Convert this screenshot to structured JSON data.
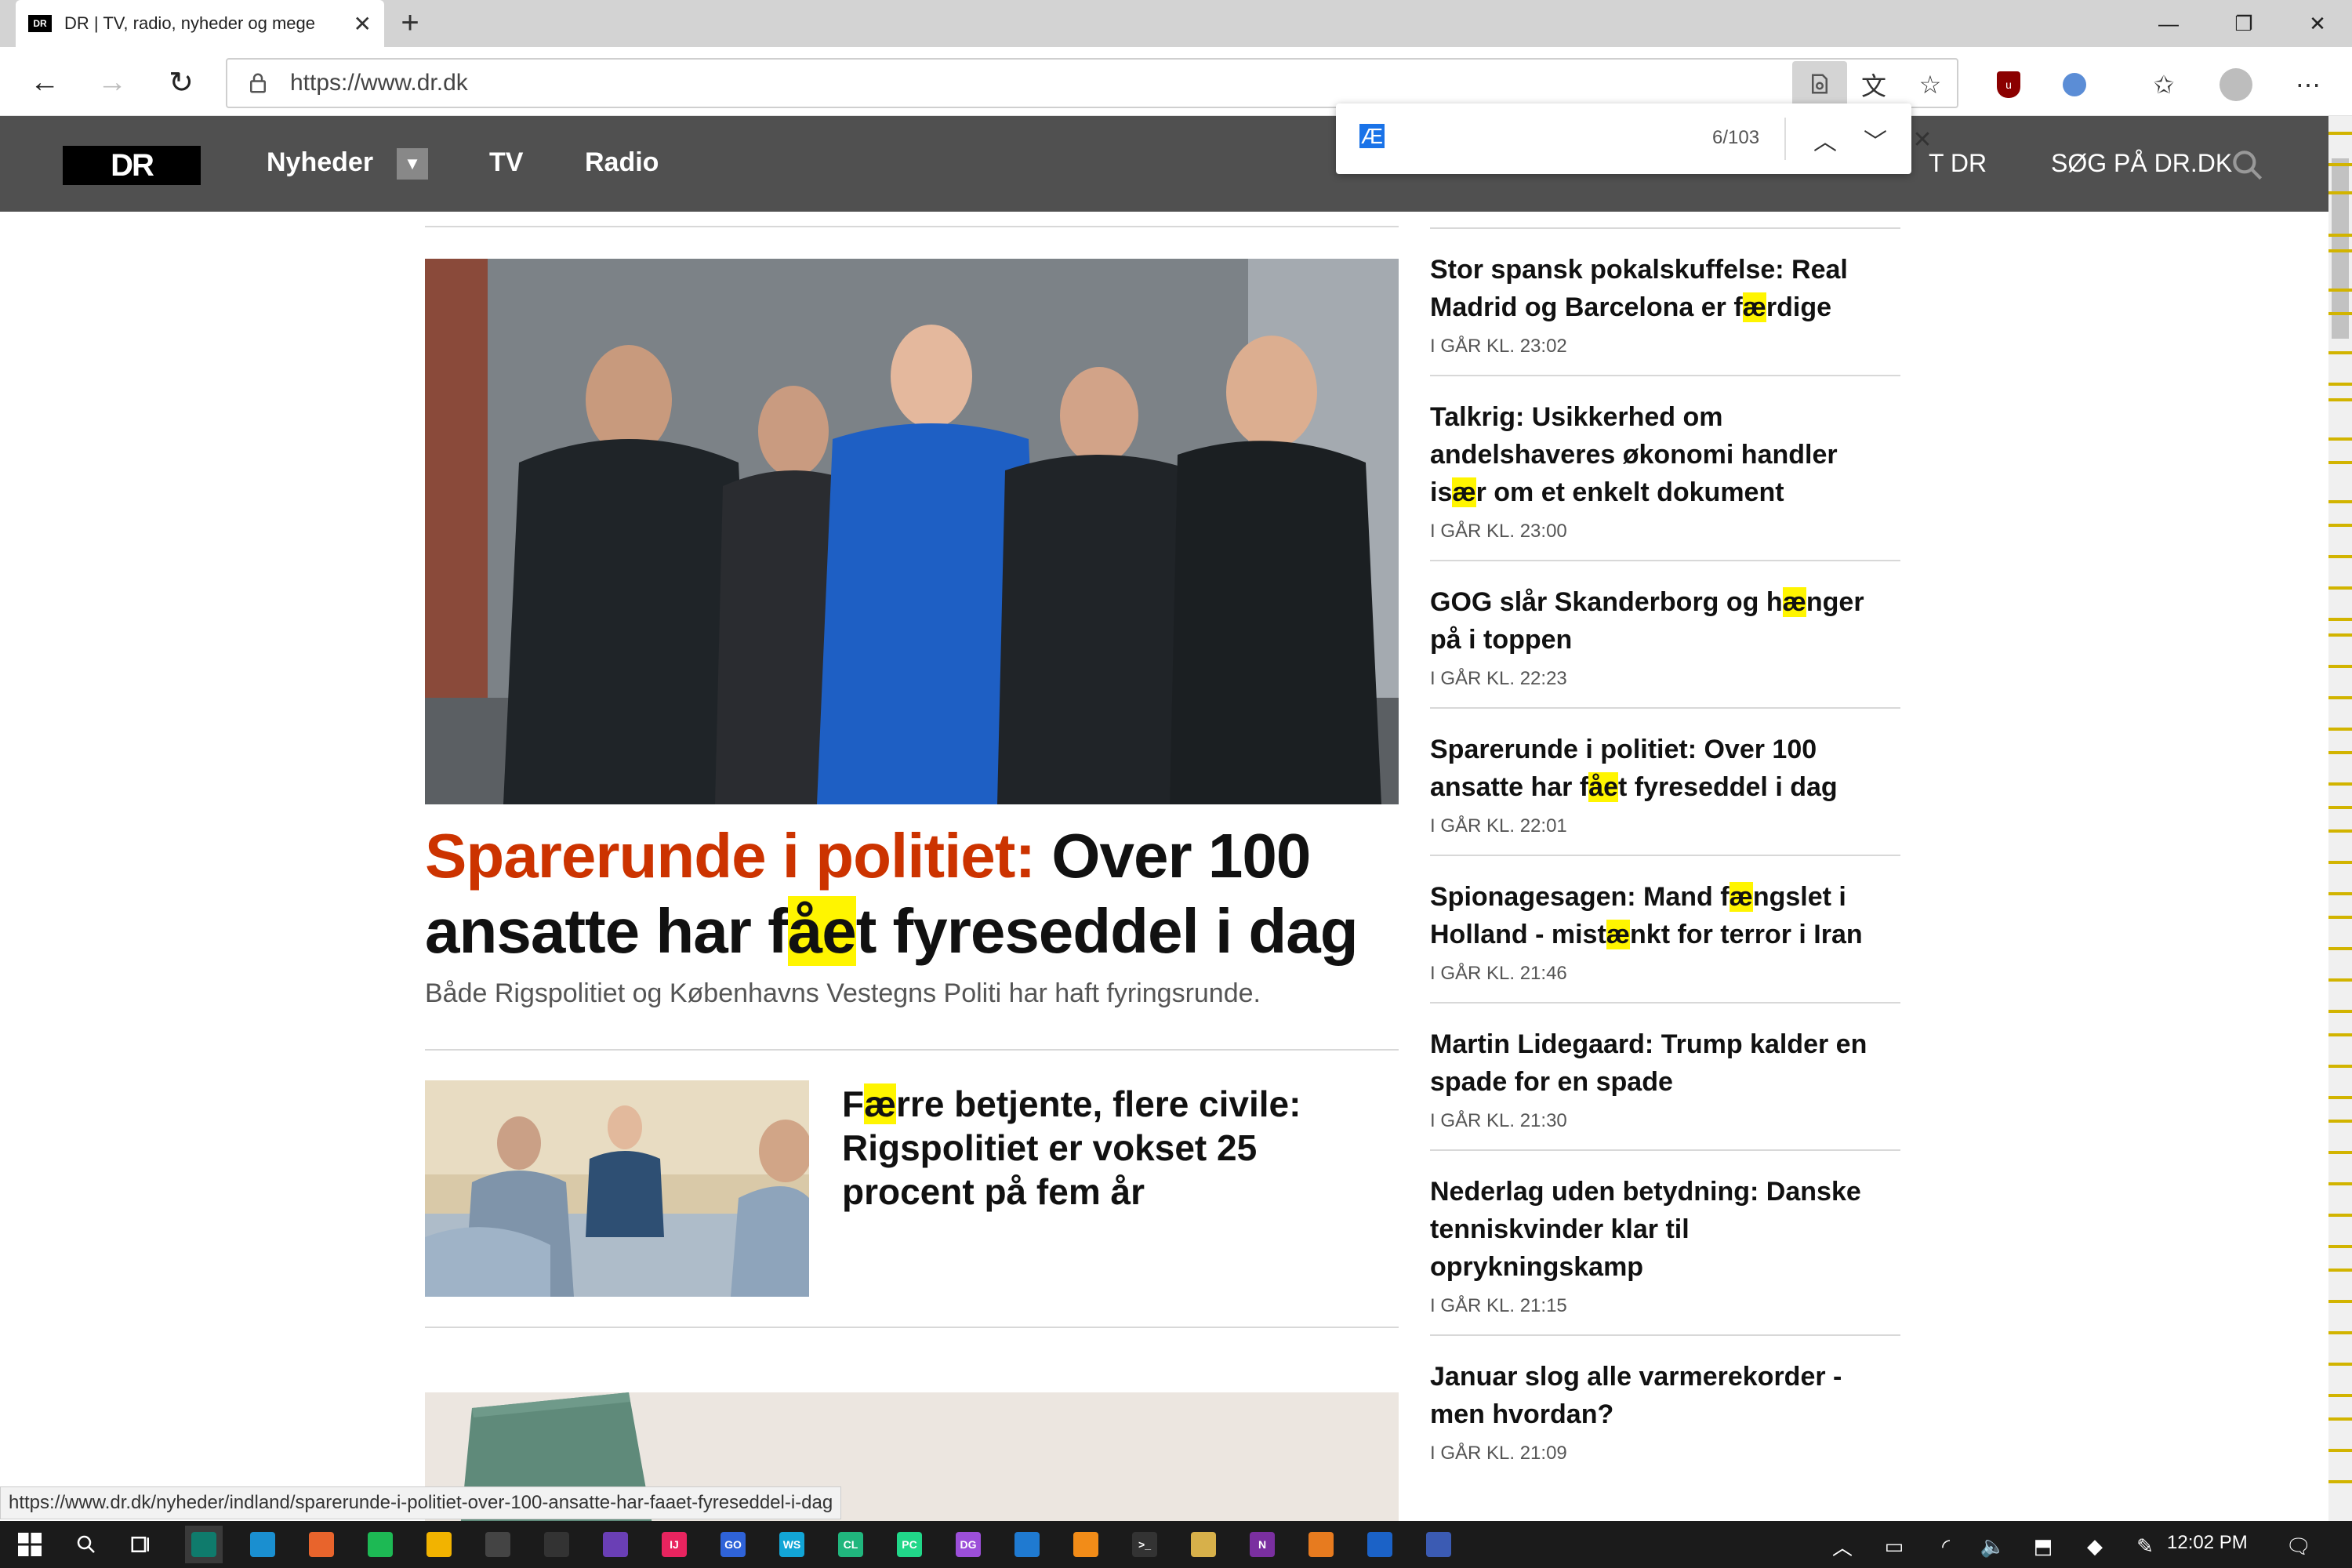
{
  "browser": {
    "tab_title": "DR | TV, radio, nyheder og mege",
    "tab_favicon_text": "DR",
    "url": "https://www.dr.dk",
    "status_url": "https://www.dr.dk/nyheder/indland/sparerunde-i-politiet-over-100-ansatte-har-faaet-fyreseddel-i-dag"
  },
  "find": {
    "query": "Æ",
    "count": "6/103"
  },
  "site": {
    "logo": "DR",
    "nav": [
      "Nyheder",
      "TV",
      "Radio"
    ],
    "contact_fragment": "T DR",
    "search_label": "SØG PÅ DR.DK"
  },
  "main": {
    "kicker": "Sparerunde i politiet:",
    "headline_part1": " Over 100 ansatte har f",
    "headline_hl": "åe",
    "headline_part2": "t fyreseddel i dag",
    "subtitle": "Både Rigspolitiet og Københavns Vestegns Politi har haft fyringsrunde."
  },
  "secondary": {
    "pre": "F",
    "hl": "æ",
    "post": "rre betjente, flere civile: Rigspolitiet er vokset 25 procent på fem år"
  },
  "news": [
    {
      "parts": [
        "Stor spansk pokalskuffelse: Real Madrid og Barcelona er f",
        "æ",
        "rdige"
      ],
      "time": "I GÅR KL. 23:02"
    },
    {
      "parts": [
        "Talkrig: Usikkerhed om andelshaveres økonomi handler is",
        "æ",
        "r om et enkelt dokument"
      ],
      "time": "I GÅR KL. 23:00"
    },
    {
      "parts": [
        "GOG slår Skanderborg og h",
        "æ",
        "nger på i toppen"
      ],
      "time": "I GÅR KL. 22:23"
    },
    {
      "parts": [
        "Sparerunde i politiet: Over 100 ansatte har f",
        "åe",
        "t fyreseddel i dag"
      ],
      "time": "I GÅR KL. 22:01"
    },
    {
      "parts": [
        "Spionagesagen: Mand f",
        "æ",
        "ngslet i Holland - mist",
        "æ",
        "nkt for terror i Iran"
      ],
      "time": "I GÅR KL. 21:46"
    },
    {
      "parts": [
        "Martin Lidegaard: Trump kalder en spade for en spade"
      ],
      "time": "I GÅR KL. 21:30"
    },
    {
      "parts": [
        "Nederlag uden betydning: Danske tenniskvinder klar til oprykningskamp"
      ],
      "time": "I GÅR KL. 21:15"
    },
    {
      "parts": [
        "Januar slog alle varmerekorder - men hvordan?"
      ],
      "time": "I GÅR KL. 21:09"
    }
  ],
  "taskbar": {
    "clock": "12:02 PM",
    "apps": [
      {
        "name": "edge-dev",
        "color": "#0f7b6c",
        "label": ""
      },
      {
        "name": "edge",
        "color": "#1a8fd0",
        "label": ""
      },
      {
        "name": "firefox",
        "color": "#e8642c",
        "label": ""
      },
      {
        "name": "spotify",
        "color": "#1db954",
        "label": ""
      },
      {
        "name": "chrome",
        "color": "#f2b300",
        "label": ""
      },
      {
        "name": "fox-app",
        "color": "#444",
        "label": ""
      },
      {
        "name": "git-app",
        "color": "#333",
        "label": ""
      },
      {
        "name": "visual-studio",
        "color": "#6a3fb5",
        "label": ""
      },
      {
        "name": "intellij",
        "color": "#e8245f",
        "label": "IJ"
      },
      {
        "name": "goland",
        "color": "#2f63d8",
        "label": "GO"
      },
      {
        "name": "webstorm",
        "color": "#12a5d6",
        "label": "WS"
      },
      {
        "name": "clion",
        "color": "#20b67d",
        "label": "CL"
      },
      {
        "name": "pycharm",
        "color": "#21d789",
        "label": "PC"
      },
      {
        "name": "datagrip",
        "color": "#9c4fd9",
        "label": "DG"
      },
      {
        "name": "vscode",
        "color": "#1f7ad1",
        "label": ""
      },
      {
        "name": "sublime",
        "color": "#f28c18",
        "label": ""
      },
      {
        "name": "terminal",
        "color": "#333",
        "label": ">_"
      },
      {
        "name": "file-app",
        "color": "#d7b04a",
        "label": ""
      },
      {
        "name": "onenote",
        "color": "#7a2fa0",
        "label": "N"
      },
      {
        "name": "orange-app",
        "color": "#e77b1f",
        "label": ""
      },
      {
        "name": "affinity",
        "color": "#1b62c7",
        "label": ""
      },
      {
        "name": "doc-app",
        "color": "#3b5bb3",
        "label": ""
      }
    ]
  }
}
